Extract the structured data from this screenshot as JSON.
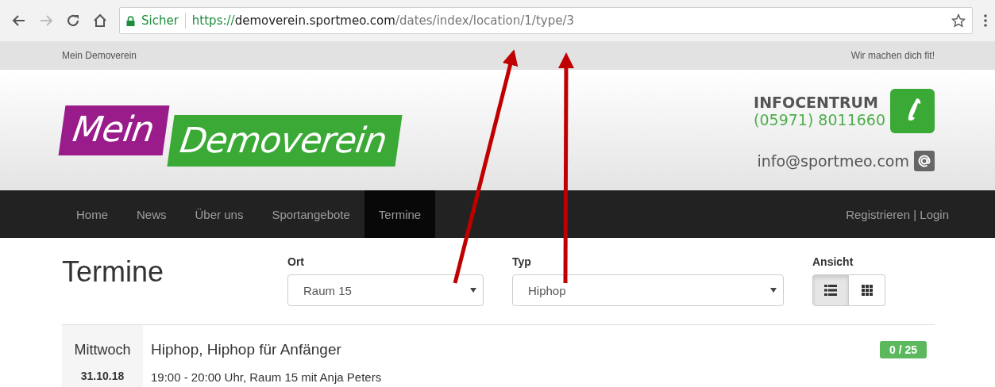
{
  "browser": {
    "security_label": "Sicher",
    "url": {
      "scheme": "https://",
      "host": "demoverein.sportmeo.com",
      "path": "/dates/index/location/1/type/3"
    }
  },
  "top_bar": {
    "left": "Mein Demoverein",
    "right": "Wir machen dich fit!"
  },
  "logo": {
    "first": "Mein",
    "second": "Demoverein"
  },
  "contact": {
    "title": "INFOCENTRUM",
    "phone": "(05971) 8011660",
    "email": "info@sportmeo.com"
  },
  "nav": {
    "items": [
      {
        "label": "Home",
        "selected": false
      },
      {
        "label": "News",
        "selected": false
      },
      {
        "label": "Über uns",
        "selected": false
      },
      {
        "label": "Sportangebote",
        "selected": false
      },
      {
        "label": "Termine",
        "selected": true
      }
    ],
    "account": "Registrieren | Login"
  },
  "page_title": "Termine",
  "filters": [
    {
      "label": "Ort",
      "value": "Raum 15"
    },
    {
      "label": "Typ",
      "value": "Hiphop"
    }
  ],
  "view": {
    "label": "Ansicht",
    "options": [
      {
        "kind": "list",
        "selected": true
      },
      {
        "kind": "grid",
        "selected": false
      }
    ]
  },
  "events": [
    {
      "weekday": "Mittwoch",
      "date": "31.10.18",
      "title": "Hiphop, Hiphop für Anfänger",
      "details": "19:00 - 20:00 Uhr, Raum 15 mit Anja Peters",
      "capacity": "0 / 25"
    }
  ]
}
